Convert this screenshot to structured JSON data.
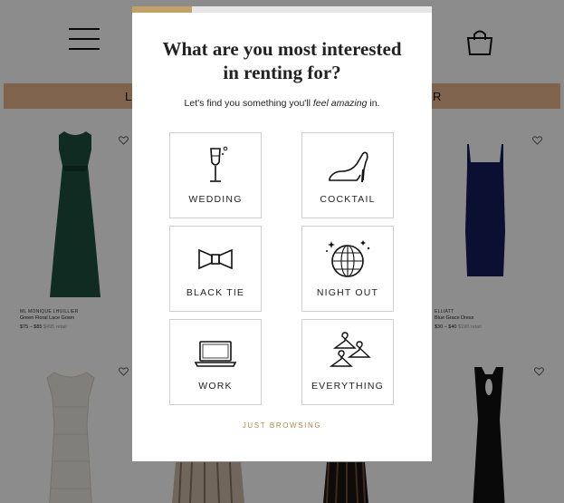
{
  "background": {
    "promo_left": "L",
    "promo_right": "R",
    "products": [
      {
        "brand": "ML MONIQUE LHUILLIER",
        "name": "Green Floral Lace Gown",
        "price": "$75 – $85",
        "retail": "$495 retail"
      },
      {
        "brand": "ELLIATT",
        "name": "Blue Grace Dress",
        "price": "$30 – $40",
        "retail": "$190 retail"
      }
    ]
  },
  "modal": {
    "progress": 0.2,
    "progress_color": "#c2a06a",
    "title_line1": "What are you most interested",
    "title_line2": "in renting for?",
    "subtitle_before": "Let's find you something you'll ",
    "subtitle_emphasis": "feel amazing",
    "subtitle_after": " in.",
    "options": [
      {
        "label": "WEDDING",
        "icon": "champagne-glass-icon"
      },
      {
        "label": "COCKTAIL",
        "icon": "high-heel-icon"
      },
      {
        "label": "BLACK TIE",
        "icon": "bow-tie-icon"
      },
      {
        "label": "NIGHT OUT",
        "icon": "disco-ball-icon"
      },
      {
        "label": "WORK",
        "icon": "laptop-icon"
      },
      {
        "label": "EVERYTHING",
        "icon": "hangers-icon"
      }
    ],
    "just_browsing": "JUST BROWSING"
  }
}
